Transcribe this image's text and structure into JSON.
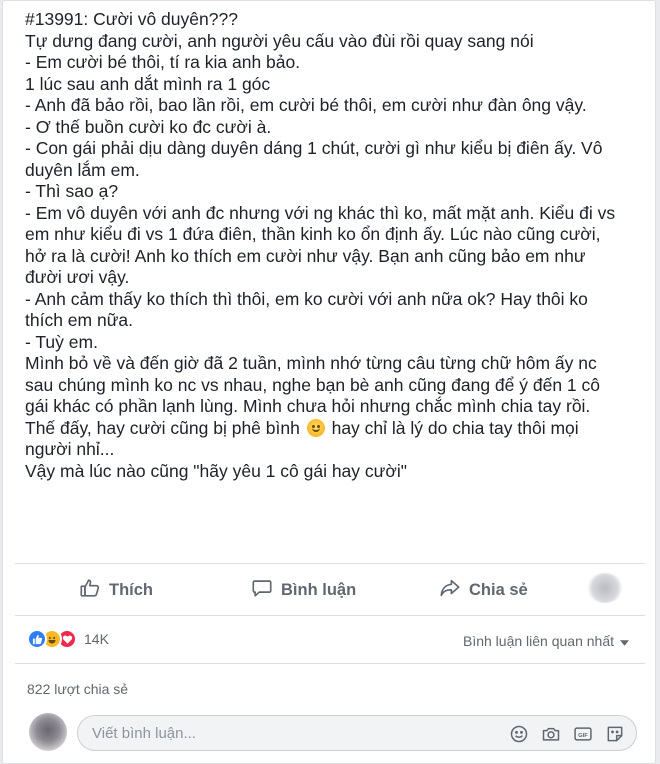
{
  "post": {
    "lines": [
      "#13991: Cười vô duyên???",
      "Tự dưng đang cười, anh người yêu cấu vào đùi rồi quay sang nói",
      "- Em cười bé thôi, tí ra kia anh bảo.",
      "1 lúc sau anh dắt mình ra 1 góc",
      "- Anh đã bảo rồi, bao lần rồi, em cười bé thôi, em cười như đàn ông vậy.",
      "- Ơ thế buồn cười ko đc cười à.",
      "- Con gái phải dịu dàng duyên dáng 1 chút, cười gì như kiểu bị điên ấy. Vô",
      "duyên lắm em.",
      "- Thì sao ạ?",
      "- Em vô duyên với anh đc nhưng với ng khác thì ko, mất mặt anh. Kiểu đi vs",
      "em như kiểu đi vs 1 đứa điên, thần kinh ko ổn định ấy. Lúc nào cũng cười,",
      "hở ra là cười! Anh ko thích em cười như vậy. Bạn anh cũng bảo em như",
      "đười ươi vậy.",
      "- Anh cảm thấy ko thích thì thôi, em ko cười với anh nữa ok? Hay thôi ko",
      "thích em nữa.",
      "- Tuỳ em.",
      "Mình bỏ về và đến giờ đã 2 tuần, mình nhớ từng câu từng chữ hôm ấy nc",
      "sau chúng mình ko nc vs nhau, nghe bạn bè anh cũng đang để ý đến 1 cô",
      "gái khác có phần lạnh lùng. Mình chưa hỏi nhưng chắc mình chia tay rồi."
    ],
    "line_emoji_before": "Thế đấy, hay cười cũng bị phê bình",
    "line_emoji_after": "hay chỉ là lý do chia tay thôi mọi",
    "lines_end": [
      "người nhỉ...",
      "Vậy mà lúc nào cũng \"hãy yêu 1 cô gái hay cười\""
    ],
    "emoji_icon": "smile-emoji-icon"
  },
  "actions": {
    "like": "Thích",
    "comment": "Bình luận",
    "share": "Chia sẻ"
  },
  "reactions": {
    "count": "14K",
    "types": [
      "like",
      "haha",
      "love"
    ]
  },
  "sort_label": "Bình luận liên quan nhất",
  "shares": "822 lượt chia sẻ",
  "comment_input": {
    "placeholder": "Viết bình luận...",
    "value": ""
  },
  "colors": {
    "accent": "#2e7cf6",
    "love": "#f0284a",
    "haha": "#f7b928",
    "muted": "#606770"
  }
}
